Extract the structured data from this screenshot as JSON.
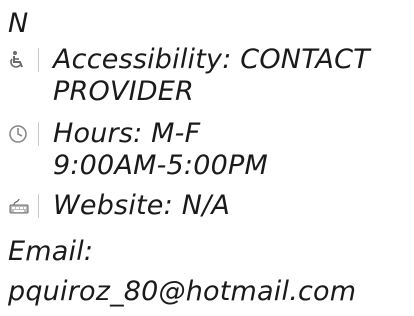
{
  "header_text": "N",
  "details": [
    {
      "icon": "wheelchair-icon",
      "lines": [
        "Accessibility: CONTACT",
        "PROVIDER"
      ]
    },
    {
      "icon": "clock-icon",
      "lines": [
        "Hours: M-F",
        "9:00AM-5:00PM"
      ]
    },
    {
      "icon": "keyboard-icon",
      "lines": [
        "Website: N/A"
      ]
    }
  ],
  "email_label": "Email:",
  "email_value": "pquiroz_80@hotmail.com"
}
